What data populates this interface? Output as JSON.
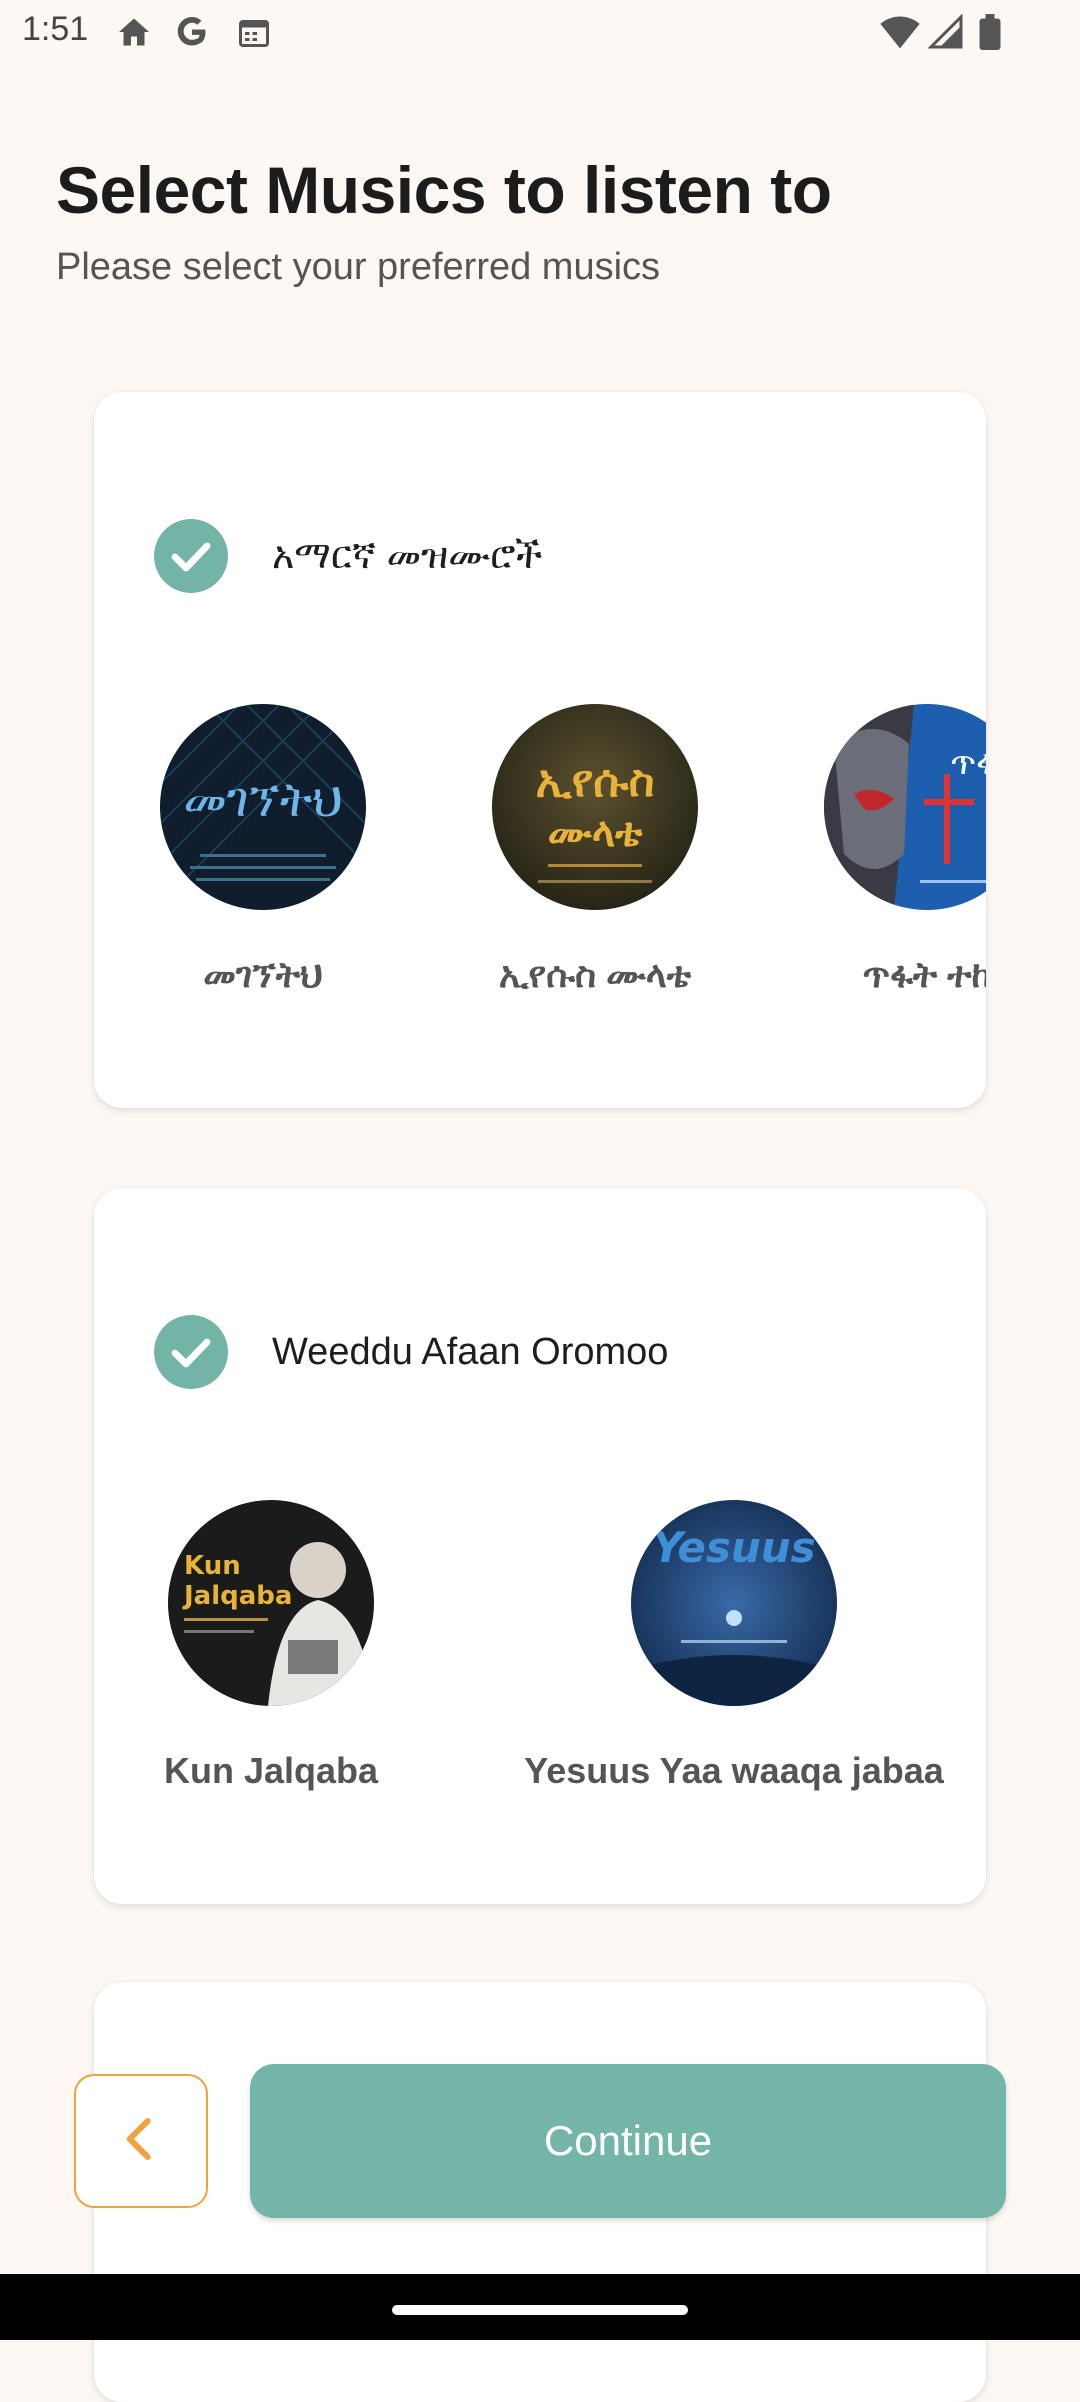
{
  "status_bar": {
    "time": "1:51",
    "left_icons": [
      "home-icon",
      "google-icon",
      "calendar-icon"
    ],
    "right_icons": [
      "wifi-icon",
      "signal-icon",
      "battery-icon"
    ]
  },
  "header": {
    "title": "Select Musics to listen to",
    "subtitle": "Please select your preferred musics"
  },
  "categories": [
    {
      "title": "አማርኛ መዝሙሮች",
      "selected": true,
      "items": [
        {
          "label": "መገኘትህ"
        },
        {
          "label": "ኢየሱስ ሙላቴ"
        },
        {
          "label": "ጥፋት ተከ"
        }
      ]
    },
    {
      "title": "Weeddu Afaan Oromoo",
      "selected": true,
      "items": [
        {
          "label": "Kun Jalqaba"
        },
        {
          "label": "Yesuus Yaa waaqa jabaa"
        }
      ]
    }
  ],
  "footer": {
    "back_icon": "chevron-left-icon",
    "continue_label": "Continue"
  },
  "colors": {
    "accent": "#73b5a6",
    "back_border": "#f2a23b",
    "background": "#fdf8f4"
  }
}
